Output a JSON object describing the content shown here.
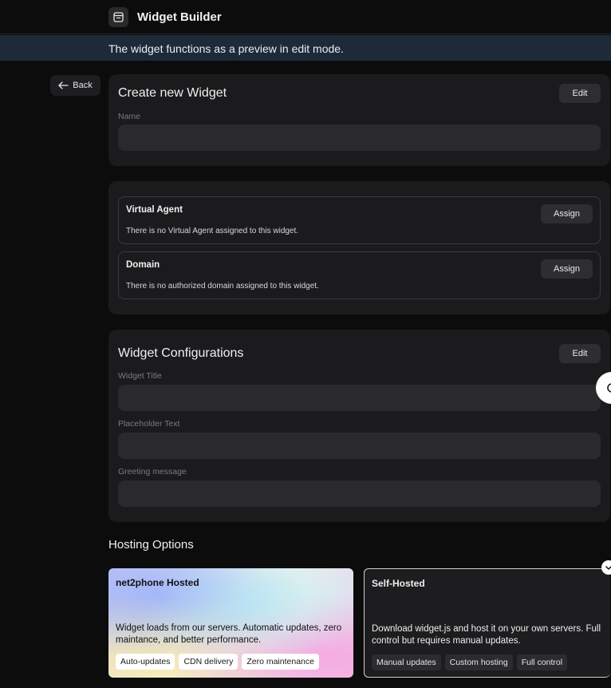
{
  "header": {
    "title": "Widget Builder",
    "icon": "widget-icon"
  },
  "banner": {
    "text": "The widget functions as a preview in edit mode."
  },
  "back": {
    "label": "Back",
    "icon": "arrow-left-icon"
  },
  "create_card": {
    "title": "Create new Widget",
    "edit_label": "Edit",
    "name_label": "Name",
    "name_value": ""
  },
  "assignments": [
    {
      "title": "Virtual Agent",
      "description": "There is no Virtual Agent assigned to this widget.",
      "button": "Assign"
    },
    {
      "title": "Domain",
      "description": "There is no authorized domain assigned to this widget.",
      "button": "Assign"
    }
  ],
  "config_card": {
    "title": "Widget Configurations",
    "edit_label": "Edit",
    "fields": [
      {
        "label": "Widget Title",
        "value": ""
      },
      {
        "label": "Placeholder Text",
        "value": ""
      },
      {
        "label": "Greeting message",
        "value": ""
      }
    ]
  },
  "hosting": {
    "heading": "Hosting Options",
    "options": [
      {
        "title": "net2phone Hosted",
        "description": "Widget loads from our servers. Automatic updates, zero maintance, and better performance.",
        "tags": [
          "Auto-updates",
          "CDN delivery",
          "Zero maintenance"
        ]
      },
      {
        "title": "Self-Hosted",
        "description": "Download widget.js and host it on your own servers. Full control but requires manual updates.",
        "tags": [
          "Manual updates",
          "Custom hosting",
          "Full control"
        ],
        "selected": true
      }
    ]
  }
}
